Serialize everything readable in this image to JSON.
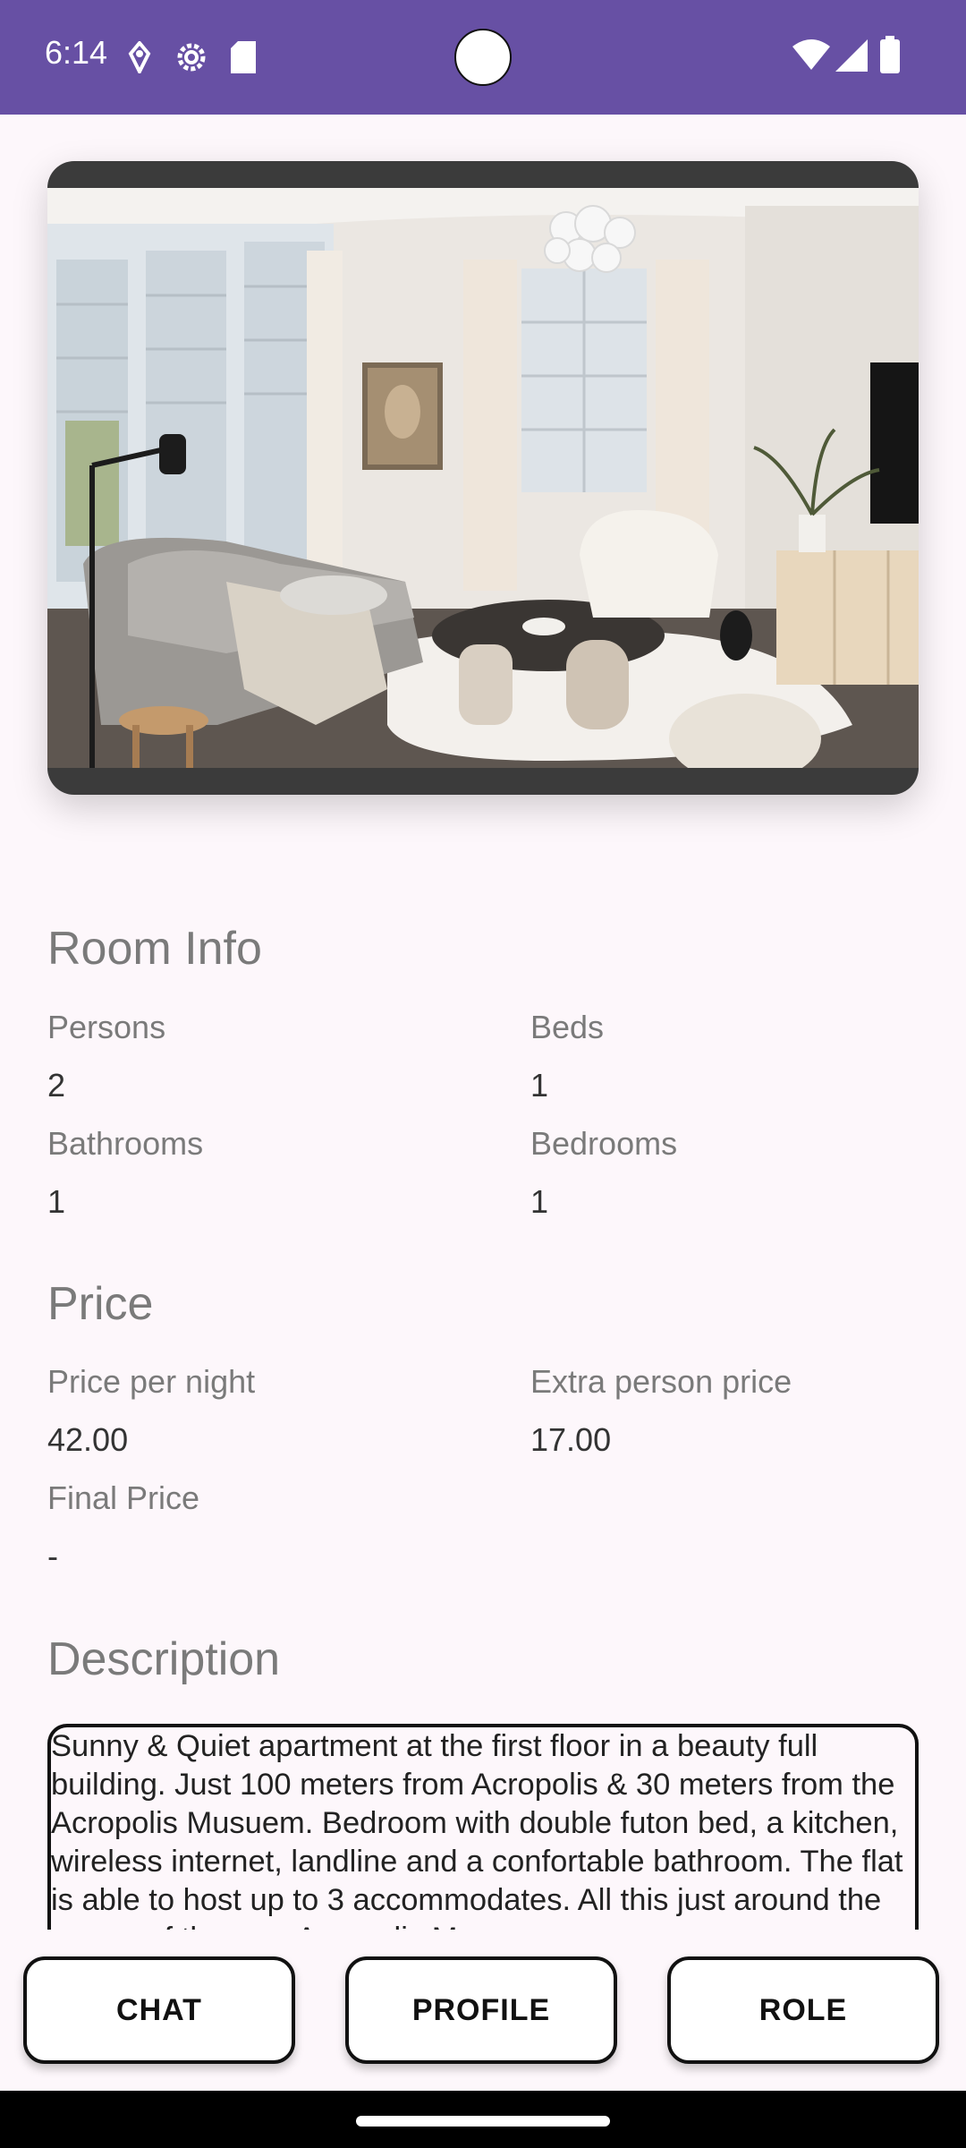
{
  "status_bar": {
    "time": "6:14",
    "left_icons": [
      "location-icon",
      "settings-icon",
      "sd-card-icon"
    ],
    "right_icons": [
      "wifi-icon",
      "cellular-signal-icon",
      "battery-icon"
    ],
    "background": "#6750a4"
  },
  "image": {
    "description": "room-photo"
  },
  "room_info": {
    "title": "Room Info",
    "persons_label": "Persons",
    "persons_value": "2",
    "beds_label": "Beds",
    "beds_value": "1",
    "bathrooms_label": "Bathrooms",
    "bathrooms_value": "1",
    "bedrooms_label": "Bedrooms",
    "bedrooms_value": "1"
  },
  "price": {
    "title": "Price",
    "per_night_label": "Price per night",
    "per_night_value": "42.00",
    "extra_person_label": "Extra person price",
    "extra_person_value": "17.00",
    "final_label": "Final Price",
    "final_value": "-"
  },
  "description": {
    "title": "Description",
    "text": "Sunny & Quiet apartment  at the first floor in a beauty full building. Just 100 meters from Acropolis & 30 meters from the Acropolis Musuem. Bedroom with double futon bed, a kitchen, wireless internet, landline and a confortable bathroom.  The flat is able to host up to 3 accommodates. All this just around the corner of the new Acropolis Museum."
  },
  "buttons": {
    "chat": "CHAT",
    "profile": "PROFILE",
    "role": "ROLE"
  }
}
